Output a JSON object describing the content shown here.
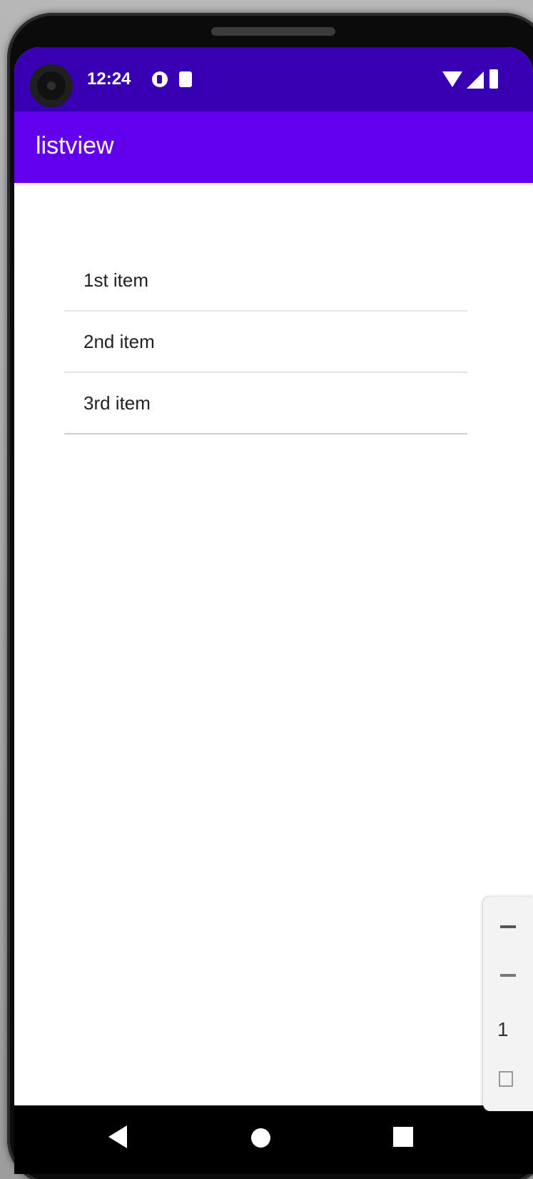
{
  "status_bar": {
    "time": "12:24"
  },
  "app_bar": {
    "title": "listview"
  },
  "list": {
    "items": [
      {
        "label": "1st item"
      },
      {
        "label": "2nd item"
      },
      {
        "label": "3rd item"
      }
    ]
  },
  "side_panel": {
    "visible_digit": "1"
  },
  "icons": {
    "status": [
      "notification-circle-icon",
      "sd-card-icon",
      "wifi-icon",
      "signal-icon",
      "battery-icon"
    ],
    "navigation": [
      "back-icon",
      "home-icon",
      "overview-icon"
    ]
  },
  "colors": {
    "status_bar": "#3700b3",
    "app_bar": "#6200ee"
  }
}
